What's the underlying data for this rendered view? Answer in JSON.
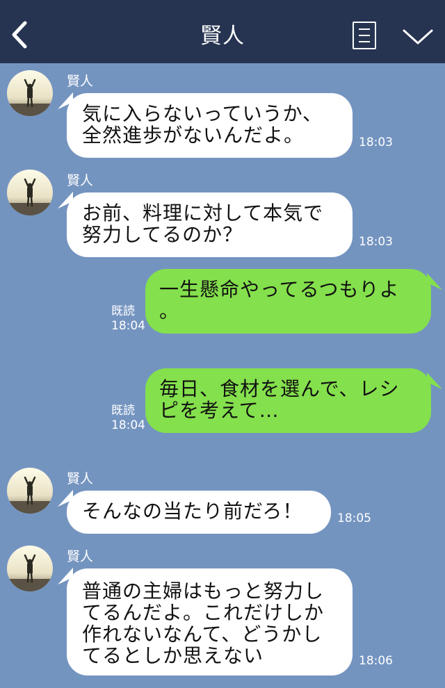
{
  "header": {
    "title": "賢人"
  },
  "messages": [
    {
      "side": "left",
      "sender": "賢人",
      "text": "気に入らないっていうか、\n全然進歩がないんだよ。",
      "time": "18:03"
    },
    {
      "side": "left",
      "sender": "賢人",
      "text": "お前、料理に対して本気で\n努力してるのか？",
      "time": "18:03"
    },
    {
      "side": "right",
      "read": "既読",
      "text": "一生懸命やってるつもりよ\n。",
      "time": "18:04"
    },
    {
      "side": "right",
      "read": "既読",
      "text": "毎日、食材を選んで、レシ\nピを考えて…",
      "time": "18:04"
    },
    {
      "side": "left",
      "sender": "賢人",
      "text": "そんなの当たり前だろ！",
      "time": "18:05"
    },
    {
      "side": "left",
      "sender": "賢人",
      "text": "普通の主婦はもっと努力し\nてるんだよ。これだけしか\n作れないなんて、どうかし\nてるとしか思えない",
      "time": "18:06"
    }
  ],
  "colors": {
    "background": "#7494c0",
    "header": "#263451",
    "bubble_left": "#ffffff",
    "bubble_right": "#84e04c"
  }
}
